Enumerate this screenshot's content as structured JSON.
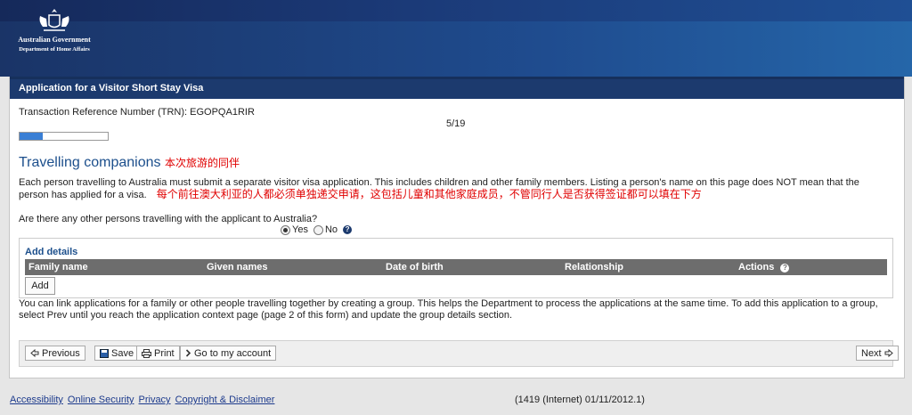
{
  "header": {
    "logo_line1": "Australian Government",
    "logo_line2": "Department of Home Affairs",
    "icon": "coat-of-arms-icon"
  },
  "page": {
    "title": "Application for a Visitor Short Stay Visa",
    "trn": "Transaction Reference Number (TRN): EGOPQA1RIR",
    "page_count": "5/19",
    "progress_fraction": 0.263
  },
  "section": {
    "heading": "Travelling companions",
    "heading_annotation": "本次旅游的同伴",
    "description": "Each person travelling to Australia must submit a separate visitor visa application. This includes children and other family members. Listing a person's name on this page does NOT mean that the person has applied for a visa.",
    "description_annotation": "每个前往澳大利亚的人都必须单独递交申请，这包括儿童和其他家庭成员，不管同行人是否获得签证都可以填在下方",
    "question": "Are there any other persons travelling with the applicant to Australia?",
    "yes_label": "Yes",
    "no_label": "No",
    "selected": "Yes"
  },
  "details": {
    "title": "Add details",
    "columns": [
      "Family name",
      "Given names",
      "Date of birth",
      "Relationship",
      "Actions"
    ],
    "add_label": "Add"
  },
  "group_text": "You can link applications for a family or other people travelling together by creating a group. This helps the Department to process the applications at the same time. To add this application to a group, select Prev until you reach the application context page (page 2 of this form) and update the group details section.",
  "nav": {
    "previous": "Previous",
    "save": "Save",
    "print": "Print",
    "account": "Go to my account",
    "next": "Next"
  },
  "footer": {
    "links": [
      "Accessibility",
      "Online Security",
      "Privacy",
      "Copyright & Disclaimer"
    ],
    "version": "(1419 (Internet) 01/11/2012.1)"
  },
  "colors": {
    "header_blue": "#1c3a6e",
    "heading_blue": "#1c4f8c",
    "annotation_red": "#e00000",
    "table_head_gray": "#6d6d6d"
  }
}
